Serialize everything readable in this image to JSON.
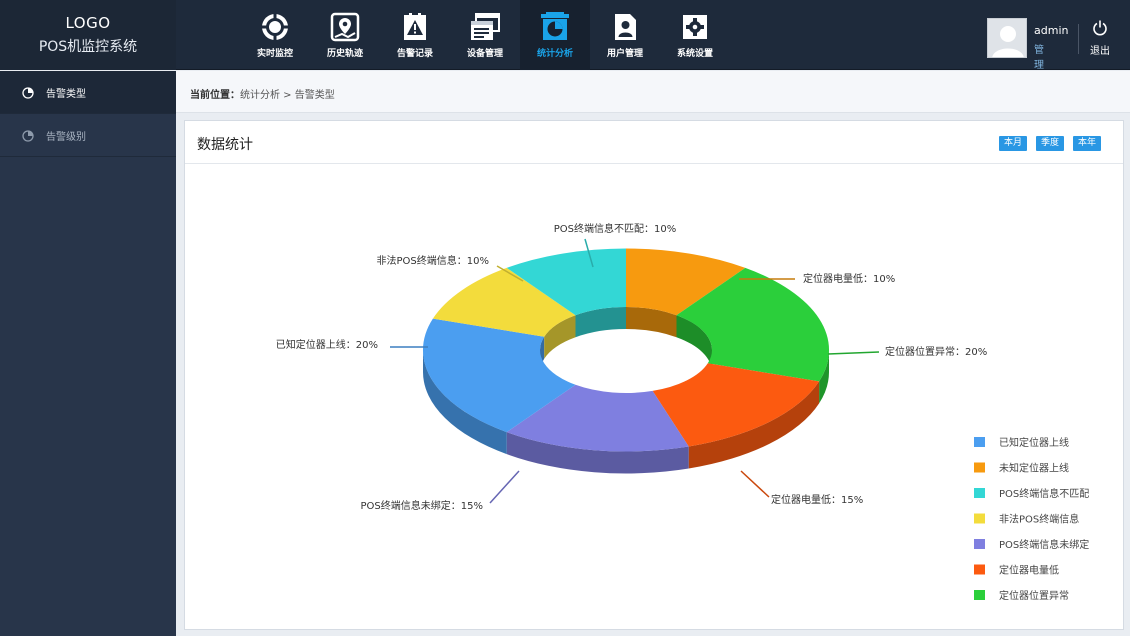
{
  "header": {
    "logo": "LOGO",
    "system_name": "POS机监控系统",
    "nav": [
      {
        "label": "实时监控",
        "icon": "crosshair-target-icon"
      },
      {
        "label": "历史轨迹",
        "icon": "map-pin-route-icon"
      },
      {
        "label": "告警记录",
        "icon": "warning-triangle-icon"
      },
      {
        "label": "设备管理",
        "icon": "device-windows-icon"
      },
      {
        "label": "统计分析",
        "icon": "pie-chart-icon",
        "active": true
      },
      {
        "label": "用户管理",
        "icon": "user-card-icon"
      },
      {
        "label": "系统设置",
        "icon": "gear-settings-icon"
      }
    ],
    "user": {
      "name": "admin",
      "role": "管理员",
      "logout": "退出"
    }
  },
  "sidebar": {
    "items": [
      {
        "label": "告警类型",
        "active": true
      },
      {
        "label": "告警级别"
      }
    ]
  },
  "breadcrumb": {
    "prefix": "当前位置：",
    "path": "统计分析 > 告警类型"
  },
  "panel": {
    "title": "数据统计",
    "period_buttons": [
      "本月",
      "季度",
      "本年"
    ]
  },
  "colors": {
    "accent": "#2997e4",
    "topbar": "#1e2a3b",
    "sidebar": "#28354a"
  },
  "chart_data": {
    "type": "pie",
    "style": "3d-donut",
    "series": [
      {
        "name": "未知定位器上线",
        "value": 10,
        "color": "#f79a0f",
        "callout": "定位器电量低：10%"
      },
      {
        "name": "定位器位置异常",
        "value": 20,
        "color": "#2bcf3b",
        "callout": "定位器位置异常：20%"
      },
      {
        "name": "定位器电量低",
        "value": 15,
        "color": "#fc5a10",
        "callout": "定位器电量低：15%"
      },
      {
        "name": "POS终端信息未绑定",
        "value": 15,
        "color": "#7f7fe0",
        "callout": "POS终端信息未绑定：15%"
      },
      {
        "name": "已知定位器上线",
        "value": 20,
        "color": "#4b9ef0",
        "callout": "已知定位器上线：20%"
      },
      {
        "name": "非法POS终端信息",
        "value": 10,
        "color": "#f3dc3c",
        "callout": "非法POS终端信息：10%"
      },
      {
        "name": "POS终端信息不匹配",
        "value": 10,
        "color": "#33d7d5",
        "callout": "POS终端信息不匹配：10%"
      }
    ],
    "legend": [
      {
        "label": "已知定位器上线",
        "color": "#4b9ef0"
      },
      {
        "label": "未知定位器上线",
        "color": "#f79a0f"
      },
      {
        "label": "POS终端信息不匹配",
        "color": "#33d7d5"
      },
      {
        "label": "非法POS终端信息",
        "color": "#f3dc3c"
      },
      {
        "label": "POS终端信息未绑定",
        "color": "#7f7fe0"
      },
      {
        "label": "定位器电量低",
        "color": "#fc5a10"
      },
      {
        "label": "定位器位置异常",
        "color": "#2bcf3b"
      }
    ],
    "legend_position": "bottom-right"
  }
}
